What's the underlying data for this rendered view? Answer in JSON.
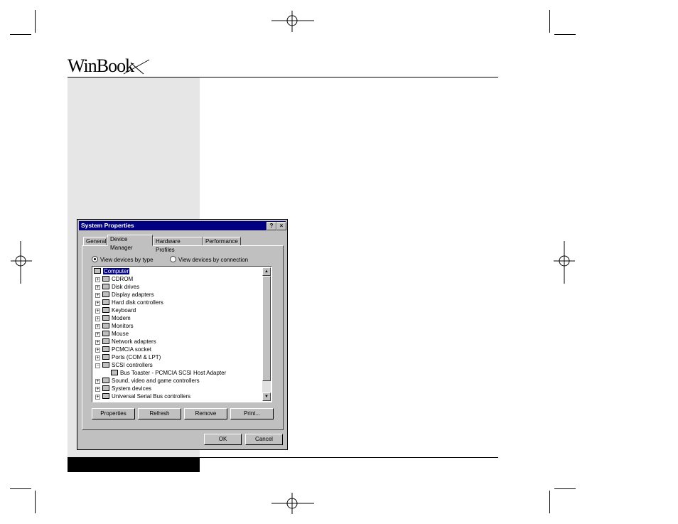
{
  "logo": {
    "text": "WinBook"
  },
  "dialog": {
    "title": "System Properties",
    "help_btn": "?",
    "close_btn": "×",
    "tabs": [
      "General",
      "Device Manager",
      "Hardware Profiles",
      "Performance"
    ],
    "radio_type": "View devices by type",
    "radio_connection": "View devices by connection",
    "devices": [
      "Computer",
      "CDROM",
      "Disk drives",
      "Display adapters",
      "Hard disk controllers",
      "Keyboard",
      "Modem",
      "Monitors",
      "Mouse",
      "Network adapters",
      "PCMCIA socket",
      "Ports (COM & LPT)",
      "SCSI controllers",
      "Bus Toaster - PCMCIA SCSI Host Adapter",
      "Sound, video and game controllers",
      "System devices",
      "Universal Serial Bus controllers"
    ],
    "buttons": {
      "properties": "Properties",
      "refresh": "Refresh",
      "remove": "Remove",
      "print": "Print...",
      "ok": "OK",
      "cancel": "Cancel"
    },
    "scroll_up": "▲",
    "scroll_down": "▼"
  }
}
